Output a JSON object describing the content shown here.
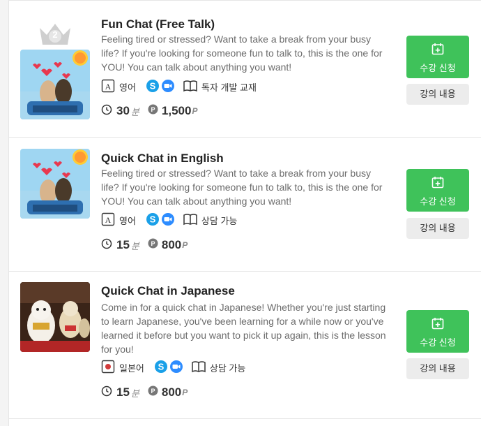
{
  "lessons": [
    {
      "title": "Fun Chat (Free Talk)",
      "description": "Feeling tired or stressed? Want to take a break from your busy life? If you're looking for someone fun to talk to, this is the one for YOU! You can talk about anything you want!",
      "language": "영어",
      "material": "독자 개발 교재",
      "duration": "30",
      "duration_unit": "분",
      "price": "1,500",
      "price_unit": "P",
      "rank": "2",
      "enroll_label": "수강 신청",
      "info_label": "강의 내용"
    },
    {
      "title": "Quick Chat in English",
      "description": "Feeling tired or stressed? Want to take a break from your busy life? If you're looking for someone fun to talk to, this is the one for YOU! You can talk about anything you want!",
      "language": "영어",
      "material": "상담 가능",
      "duration": "15",
      "duration_unit": "분",
      "price": "800",
      "price_unit": "P",
      "enroll_label": "수강 신청",
      "info_label": "강의 내용"
    },
    {
      "title": "Quick Chat in Japanese",
      "description": "Come in for a quick chat in Japanese! Whether you're just starting to learn Japanese, you've been learning for a while now or you've learned it before but you want to pick it up again, this is the lesson for you!",
      "language": "일본어",
      "material": "상담 가능",
      "duration": "15",
      "duration_unit": "분",
      "price": "800",
      "price_unit": "P",
      "enroll_label": "수강 신청",
      "info_label": "강의 내용"
    }
  ],
  "colors": {
    "enroll_button": "#3fc25a",
    "info_button": "#ececec",
    "skype": "#1aa0e8",
    "zoom": "#2d8cff"
  }
}
